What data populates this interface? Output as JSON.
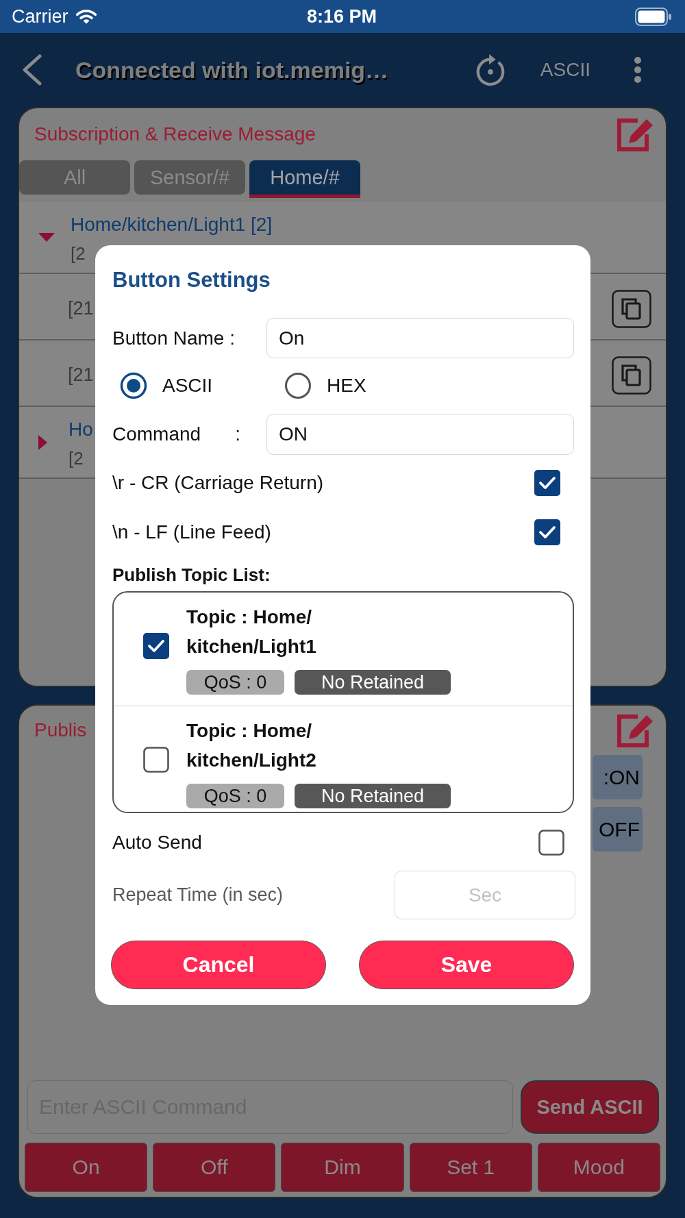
{
  "status_bar": {
    "carrier": "Carrier",
    "time": "8:16 PM"
  },
  "nav_bar": {
    "title": "Connected with iot.memig…",
    "mode": "ASCII"
  },
  "subscription_panel": {
    "title": "Subscription & Receive Message",
    "tabs": [
      {
        "label": "All",
        "selected": false
      },
      {
        "label": "Sensor/#",
        "selected": false
      },
      {
        "label": "Home/#",
        "selected": true
      }
    ],
    "groups": [
      {
        "title": "Home/kitchen/Light1 [2]",
        "subtitle": "[2",
        "expanded": true,
        "messages": [
          "[21",
          "[21"
        ]
      },
      {
        "title": "Ho",
        "subtitle": "[2",
        "expanded": false
      }
    ]
  },
  "publish_panel": {
    "title": "Publis",
    "buttons": [
      ":ON",
      "OFF"
    ],
    "command_field": {
      "placeholder": "Enter ASCII Command"
    },
    "send_button": "Send ASCII",
    "quick_buttons": [
      "On",
      "Off",
      "Dim",
      "Set 1",
      "Mood"
    ]
  },
  "dialog": {
    "title": "Button Settings",
    "button_name": {
      "label": "Button Name :",
      "value": "On"
    },
    "formats": [
      {
        "label": "ASCII",
        "selected": true
      },
      {
        "label": "HEX",
        "selected": false
      }
    ],
    "command": {
      "label": "Command",
      "colon": ":",
      "value": "ON"
    },
    "options": [
      {
        "label": "\\r - CR (Carriage Return)",
        "checked": true
      },
      {
        "label": "\\n - LF (Line Feed)",
        "checked": true
      }
    ],
    "topic_list": {
      "label": "Publish Topic List:",
      "topics": [
        {
          "topic": "Topic : Home/kitchen/Light1",
          "checked": true,
          "qos": "QoS : 0",
          "retain": "No Retained"
        },
        {
          "topic": "Topic : Home/kitchen/Light2",
          "checked": false,
          "qos": "QoS : 0",
          "retain": "No Retained"
        }
      ]
    },
    "auto_send": {
      "label": "Auto Send",
      "checked": false
    },
    "repeat_time": {
      "label": "Repeat Time (in sec)",
      "placeholder": "Sec"
    },
    "actions": [
      "Cancel",
      "Save"
    ]
  }
}
